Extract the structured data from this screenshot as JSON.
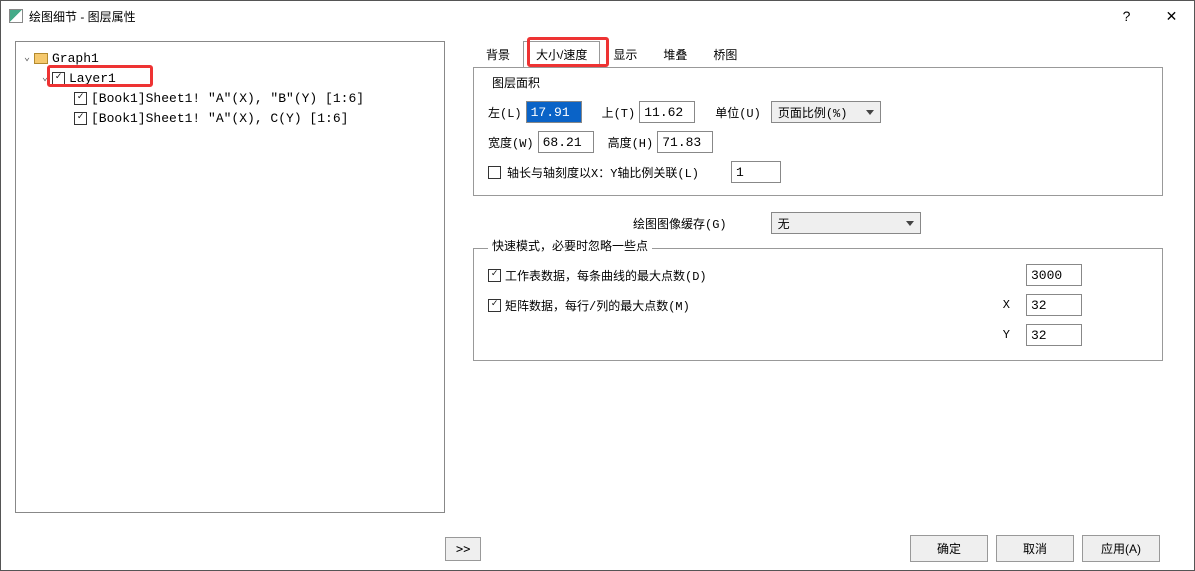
{
  "window": {
    "title": "绘图细节 - 图层属性"
  },
  "tree": {
    "root": "Graph1",
    "layer": "Layer1",
    "items": [
      "[Book1]Sheet1! \"A\"(X), \"B\"(Y) [1:6]",
      "[Book1]Sheet1! \"A\"(X), C(Y) [1:6]"
    ]
  },
  "tabs": {
    "bg": "背景",
    "size": "大小/速度",
    "show": "显示",
    "stack": "堆叠",
    "bridge": "桥图"
  },
  "layerArea": {
    "title": "图层面积",
    "leftLbl": "左(L)",
    "leftVal": "17.91",
    "topLbl": "上(T)",
    "topVal": "11.62",
    "unitLbl": "单位(U)",
    "unitVal": "页面比例(%)",
    "widthLbl": "宽度(W)",
    "widthVal": "68.21",
    "heightLbl": "高度(H)",
    "heightVal": "71.83",
    "linkLbl": "轴长与轴刻度以X：Y轴比例关联(L)",
    "linkVal": "1"
  },
  "cache": {
    "label": "绘图图像缓存(G)",
    "value": "无"
  },
  "fast": {
    "title": "快速模式，必要时忽略一些点",
    "wksLbl": "工作表数据，每条曲线的最大点数(D)",
    "wksVal": "3000",
    "matLbl": "矩阵数据，每行/列的最大点数(M)",
    "xLbl": "X",
    "xVal": "32",
    "yLbl": "Y",
    "yVal": "32"
  },
  "buttons": {
    "expand": ">>",
    "ok": "确定",
    "cancel": "取消",
    "apply": "应用(A)"
  }
}
